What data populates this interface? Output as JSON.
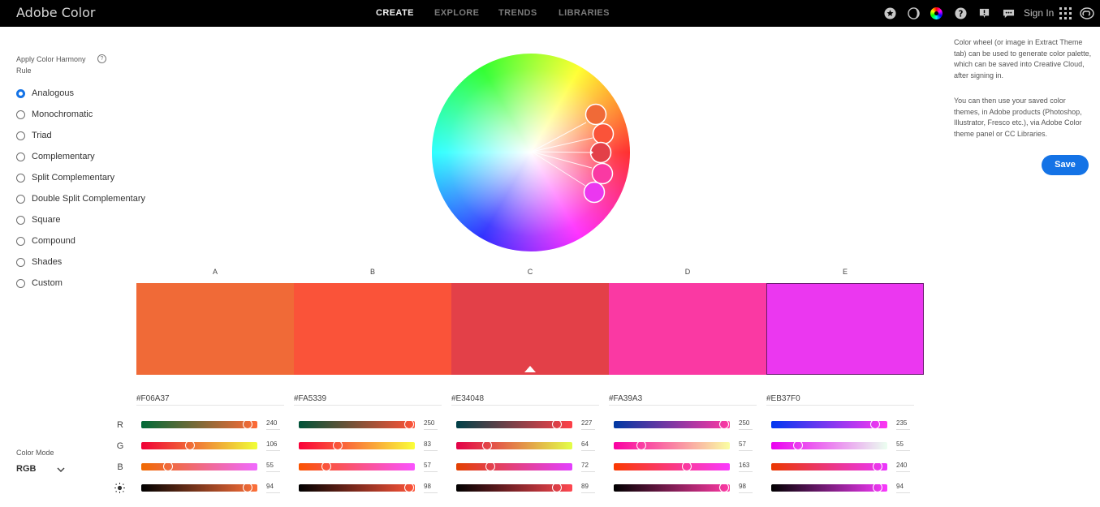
{
  "app": {
    "title": "Adobe Color",
    "nav": [
      {
        "label": "CREATE",
        "active": true
      },
      {
        "label": "EXPLORE",
        "active": false
      },
      {
        "label": "TRENDS",
        "active": false
      },
      {
        "label": "LIBRARIES",
        "active": false
      }
    ],
    "right_icons": [
      "star-icon",
      "moon-icon",
      "color-wheel-icon",
      "help-icon",
      "alert-icon",
      "feedback-icon"
    ],
    "sign_in": "Sign In"
  },
  "harmony": {
    "label": "Apply Color Harmony Rule",
    "help_glyph": "?",
    "selected": "Analogous",
    "rules": [
      "Analogous",
      "Monochromatic",
      "Triad",
      "Complementary",
      "Split Complementary",
      "Double Split Complementary",
      "Square",
      "Compound",
      "Shades",
      "Custom"
    ]
  },
  "info": {
    "paragraph1": "Color wheel (or image in Extract Theme tab) can be used to generate color palette, which can be saved into Creative Cloud, after signing in.",
    "paragraph2": "You can then use your saved color themes, in Adobe products (Photoshop, Illustrator, Fresco etc.), via Adobe Color theme panel or CC Libraries.",
    "save_label": "Save"
  },
  "palette": {
    "selected_base": "C",
    "swatches": [
      {
        "label": "A",
        "hex": "#F06A37",
        "r": 240,
        "g": 106,
        "b": 55,
        "brightness": 94
      },
      {
        "label": "B",
        "hex": "#FA5339",
        "r": 250,
        "g": 83,
        "b": 57,
        "brightness": 98
      },
      {
        "label": "C",
        "hex": "#E34048",
        "r": 227,
        "g": 64,
        "b": 72,
        "brightness": 89
      },
      {
        "label": "D",
        "hex": "#FA39A3",
        "r": 250,
        "g": 57,
        "b": 163,
        "brightness": 98
      },
      {
        "label": "E",
        "hex": "#EB37F0",
        "r": 235,
        "g": 55,
        "b": 240,
        "brightness": 94
      }
    ]
  },
  "channels": {
    "r": "R",
    "g": "G",
    "b": "B",
    "brightness_icon": "sun-icon"
  },
  "color_mode": {
    "label": "Color Mode",
    "value": "RGB"
  }
}
